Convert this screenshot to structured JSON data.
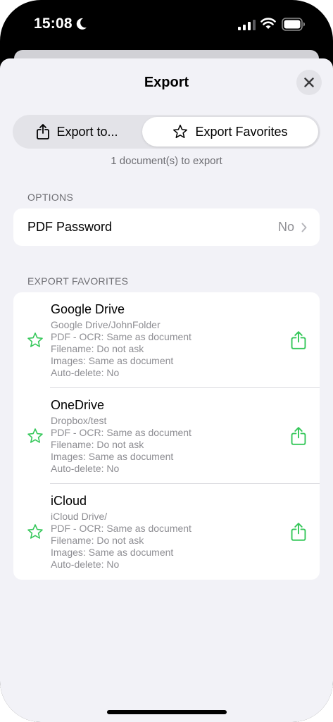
{
  "status_bar": {
    "time": "15:08"
  },
  "sheet": {
    "title": "Export",
    "segmented": {
      "left_label": "Export to...",
      "right_label": "Export Favorites",
      "selected": "right"
    },
    "doc_count": "1 document(s) to export",
    "options_header": "OPTIONS",
    "pdf_password": {
      "label": "PDF Password",
      "value": "No"
    },
    "favorites_header": "EXPORT FAVORITES",
    "favorites": [
      {
        "name": "Google Drive",
        "path": "Google Drive/JohnFolder",
        "format": "PDF - OCR: Same as document",
        "filename": "Filename: Do not ask",
        "images": "Images: Same as document",
        "auto_delete": "Auto-delete: No"
      },
      {
        "name": "OneDrive",
        "path": "Dropbox/test",
        "format": "PDF - OCR: Same as document",
        "filename": "Filename: Do not ask",
        "images": "Images: Same as document",
        "auto_delete": "Auto-delete: No"
      },
      {
        "name": "iCloud",
        "path": "iCloud Drive/",
        "format": "PDF - OCR: Same as document",
        "filename": "Filename: Do not ask",
        "images": "Images: Same as document",
        "auto_delete": "Auto-delete: No"
      }
    ]
  },
  "colors": {
    "accent_green": "#34c759",
    "sheet_bg": "#f2f2f7",
    "secondary_text": "#8e8e93"
  },
  "icons": [
    "moon-icon",
    "signal-icon",
    "wifi-icon",
    "battery-icon",
    "close-icon",
    "share-icon",
    "star-icon",
    "chevron-right-icon"
  ]
}
